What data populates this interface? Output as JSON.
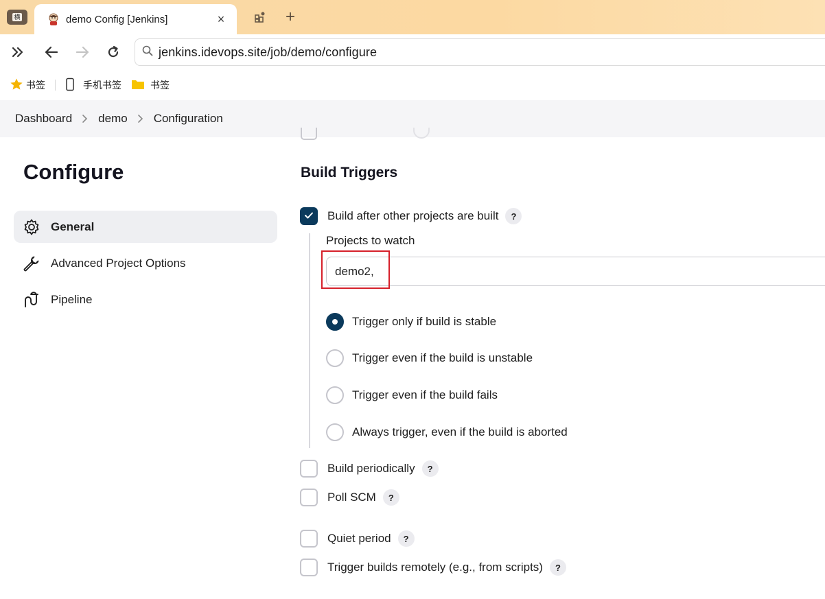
{
  "browser": {
    "tab_lead_label": "横",
    "tab_title": "demo Config [Jenkins]",
    "tab_close": "×",
    "new_tab": "+",
    "url": "jenkins.idevops.site/job/demo/configure"
  },
  "bookmarks": [
    {
      "label": "书签",
      "icon": "star-icon"
    },
    {
      "label": "手机书签",
      "icon": "phone-icon"
    },
    {
      "label": "书签",
      "icon": "folder-icon"
    }
  ],
  "breadcrumb": [
    "Dashboard",
    "demo",
    "Configuration"
  ],
  "sidebar": {
    "title": "Configure",
    "items": [
      {
        "label": "General",
        "icon": "gear-icon",
        "active": true
      },
      {
        "label": "Advanced Project Options",
        "icon": "wrench-icon",
        "active": false
      },
      {
        "label": "Pipeline",
        "icon": "pipeline-icon",
        "active": false
      }
    ]
  },
  "main": {
    "section_title": "Build Triggers",
    "build_after": {
      "label": "Build after other projects are built",
      "checked": true,
      "help": "?"
    },
    "projects_to_watch": {
      "label": "Projects to watch",
      "value": "demo2,"
    },
    "radios": [
      {
        "label": "Trigger only if build is stable",
        "checked": true
      },
      {
        "label": "Trigger even if the build is unstable",
        "checked": false
      },
      {
        "label": "Trigger even if the build fails",
        "checked": false
      },
      {
        "label": "Always trigger, even if the build is aborted",
        "checked": false
      }
    ],
    "triggers": [
      {
        "label": "Build periodically",
        "help": "?"
      },
      {
        "label": "Poll SCM",
        "help": "?"
      },
      {
        "label": "Quiet period",
        "help": "?"
      },
      {
        "label": "Trigger builds remotely (e.g., from scripts)",
        "help": "?"
      }
    ]
  },
  "colors": {
    "accent": "#0b3a5c",
    "highlight": "#d6202a"
  }
}
